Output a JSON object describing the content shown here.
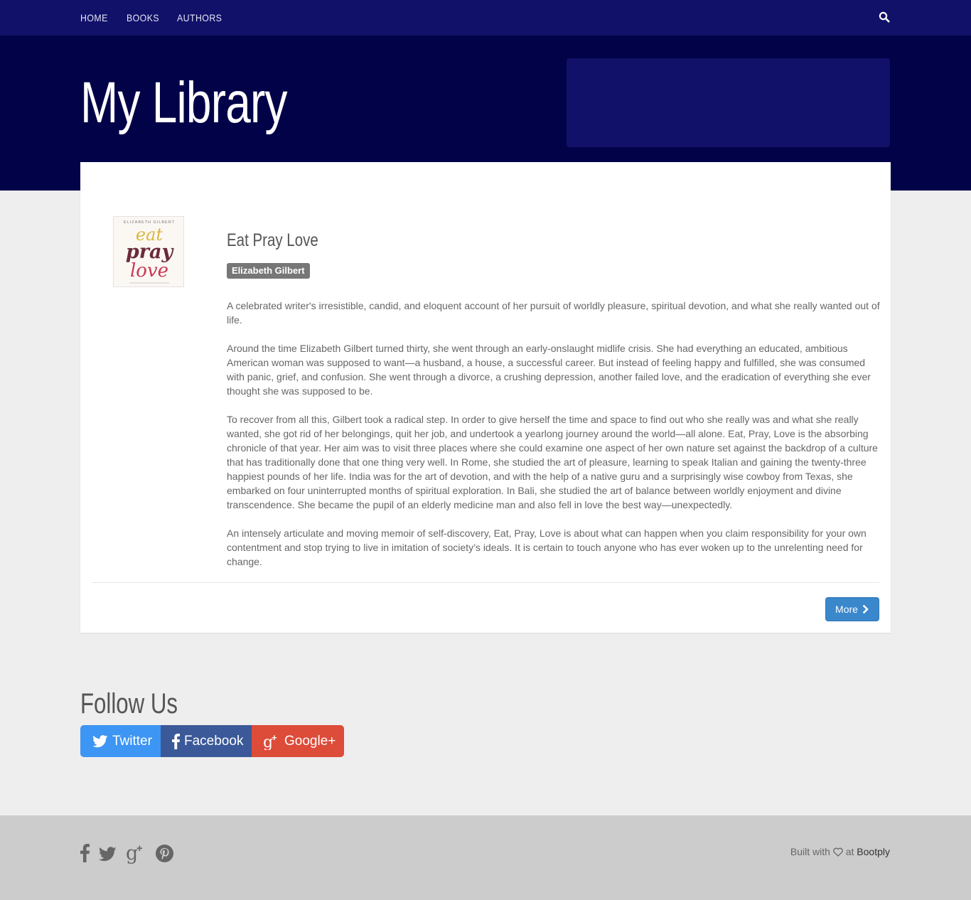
{
  "nav": {
    "items": [
      {
        "label": "HOME"
      },
      {
        "label": "BOOKS"
      },
      {
        "label": "AUTHORS"
      }
    ],
    "search_icon": "search-icon"
  },
  "hero": {
    "title": "My Library"
  },
  "book": {
    "title": "Eat Pray Love",
    "author": "Elizabeth Gilbert",
    "cover": {
      "author_line": "ELIZABETH GILBERT",
      "word1": "eat",
      "word2": "pray",
      "word3": "love"
    },
    "description": [
      "A celebrated writer's irresistible, candid, and eloquent account of her pursuit of worldly pleasure, spiritual devotion, and what she really wanted out of life.",
      "Around the time Elizabeth Gilbert turned thirty, she went through an early-onslaught midlife crisis. She had everything an educated, ambitious American woman was supposed to want—a husband, a house, a successful career. But instead of feeling happy and fulfilled, she was consumed with panic, grief, and confusion. She went through a divorce, a crushing depression, another failed love, and the eradication of everything she ever thought she was supposed to be.",
      "To recover from all this, Gilbert took a radical step. In order to give herself the time and space to find out who she really was and what she really wanted, she got rid of her belongings, quit her job, and undertook a yearlong journey around the world—all alone. Eat, Pray, Love is the absorbing chronicle of that year. Her aim was to visit three places where she could examine one aspect of her own nature set against the backdrop of a culture that has traditionally done that one thing very well. In Rome, she studied the art of pleasure, learning to speak Italian and gaining the twenty-three happiest pounds of her life. India was for the art of devotion, and with the help of a native guru and a surprisingly wise cowboy from Texas, she embarked on four uninterrupted months of spiritual exploration. In Bali, she studied the art of balance between worldly enjoyment and divine transcendence. She became the pupil of an elderly medicine man and also fell in love the best way—unexpectedly.",
      "An intensely articulate and moving memoir of self-discovery, Eat, Pray, Love is about what can happen when you claim responsibility for your own contentment and stop trying to live in imitation of society’s ideals. It is certain to touch anyone who has ever woken up to the unrelenting need for change."
    ],
    "more_label": "More"
  },
  "follow": {
    "title": "Follow Us",
    "buttons": [
      {
        "label": "Twitter",
        "icon": "twitter-icon",
        "color": "#3d95f4"
      },
      {
        "label": "Facebook",
        "icon": "facebook-icon",
        "color": "#3b5998"
      },
      {
        "label": "Google+",
        "icon": "google-plus-icon",
        "color": "#dd4b39"
      }
    ]
  },
  "footer": {
    "icons": [
      "facebook-icon",
      "twitter-icon",
      "google-plus-icon",
      "pinterest-icon"
    ],
    "built_prefix": "Built with",
    "built_mid": "at",
    "built_link": "Bootply"
  },
  "colors": {
    "nav_bg": "#11116a",
    "hero_bg": "#020248",
    "primary": "#3a87cc",
    "page_bg": "#eeeeee",
    "footer_bg": "#cccccc"
  }
}
